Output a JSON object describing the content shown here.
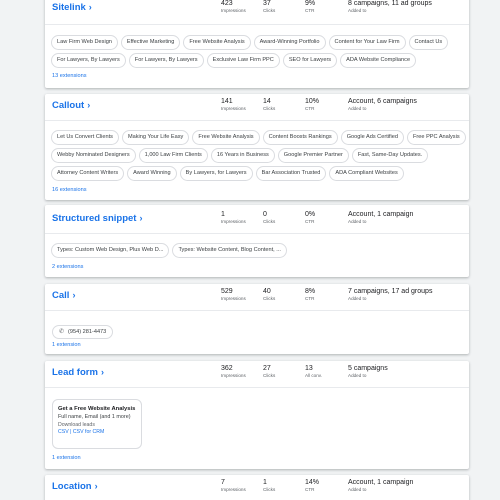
{
  "columns": {
    "impressions_label": "Impressions",
    "clicks_label": "Clicks",
    "ctr_label": "CTR",
    "added_to_label": "Added to",
    "all_conv_label": "All conv."
  },
  "sitelink": {
    "title": "Sitelink",
    "impressions": "423",
    "clicks": "37",
    "ctr": "9%",
    "added_to": "8 campaigns, 11 ad groups",
    "chips_row1": [
      "Law Firm Web Design",
      "Effective Marketing",
      "Free Website Analysis",
      "Award-Winning Portfolio",
      "Content for Your Law Firm",
      "Contact Us"
    ],
    "chips_row2": [
      "For Lawyers, By Lawyers",
      "For Lawyers, By Lawyers",
      "Exclusive Law Firm PPC",
      "SEO for Lawyers",
      "ADA Website Compliance"
    ],
    "extensions": "13 extensions"
  },
  "callout": {
    "title": "Callout",
    "impressions": "141",
    "clicks": "14",
    "ctr": "10%",
    "added_to": "Account, 6 campaigns",
    "chips_row1": [
      "Let Us Convert Clients",
      "Making Your Life Easy",
      "Free Website Analysis",
      "Content Boosts Rankings",
      "Google Ads Certified",
      "Free PPC Analysis"
    ],
    "chips_row2": [
      "Webby Nominated Designers",
      "1,000 Law Firm Clients",
      "16 Years in Business",
      "Google Premier Partner",
      "Fast, Same-Day Updates."
    ],
    "chips_row3": [
      "Attorney Content Writers",
      "Award Winning",
      "By Lawyers, for Lawyers",
      "Bar Association Trusted",
      "ADA Compliant Websites"
    ],
    "extensions": "16 extensions"
  },
  "structured_snippet": {
    "title": "Structured snippet",
    "impressions": "1",
    "clicks": "0",
    "ctr": "0%",
    "added_to": "Account, 1 campaign",
    "chips_row1": [
      "Types: Custom Web Design, Plus Web D...",
      "Types: Website Content, Blog Content, ..."
    ],
    "extensions": "2 extensions"
  },
  "call": {
    "title": "Call",
    "impressions": "529",
    "clicks": "40",
    "ctr": "8%",
    "added_to": "7 campaigns, 17 ad groups",
    "phone": "(954) 281-4473",
    "extensions": "1 extension"
  },
  "lead_form": {
    "title": "Lead form",
    "impressions": "362",
    "clicks": "27",
    "all_conv": "13",
    "added_to": "5 campaigns",
    "box_title": "Get a Free Website Analysis",
    "box_fields": "Full name, Email (and 1 more)",
    "box_download": "Download leads",
    "box_csv": "CSV | CSV for CRM",
    "extensions": "1 extension"
  },
  "location": {
    "title": "Location",
    "impressions": "7",
    "clicks": "1",
    "ctr": "14%",
    "added_to": "Account, 1 campaign"
  },
  "icons": {
    "chevron": "chevron-right-icon",
    "phone": "phone-icon"
  },
  "colors": {
    "link": "#1a73e8",
    "background": "#f1f3f4"
  }
}
